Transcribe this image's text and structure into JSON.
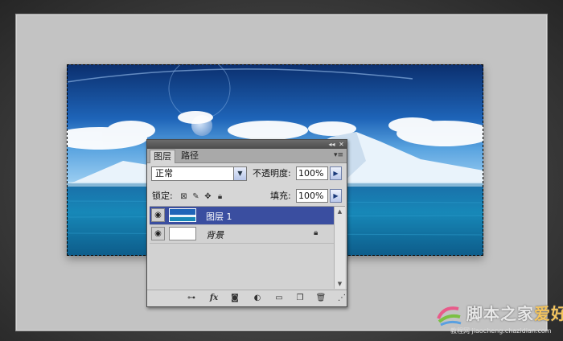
{
  "panel": {
    "tabs": [
      "图层",
      "路径"
    ],
    "blend_mode": "正常",
    "opacity_label": "不透明度:",
    "opacity_value": "100%",
    "lock_label": "锁定:",
    "fill_label": "填充:",
    "fill_value": "100%",
    "layers": [
      {
        "name": "图层 1",
        "selected": true
      },
      {
        "name": "背景",
        "selected": false,
        "locked": true
      }
    ],
    "footer_icons": [
      "link-icon",
      "fx-icon",
      "mask-icon",
      "adjustment-icon",
      "group-folder-icon",
      "new-layer-icon",
      "trash-icon"
    ]
  },
  "watermark": {
    "brand": "脚本之家",
    "brand_sub": "爱好者",
    "site_label": "教程网",
    "url": "jiaocheng.chazidian.com"
  },
  "colors": {
    "selected_layer": "#3a4ea0",
    "panel_bg": "#d6d6d6",
    "sky_top": "#0b2f6e"
  }
}
